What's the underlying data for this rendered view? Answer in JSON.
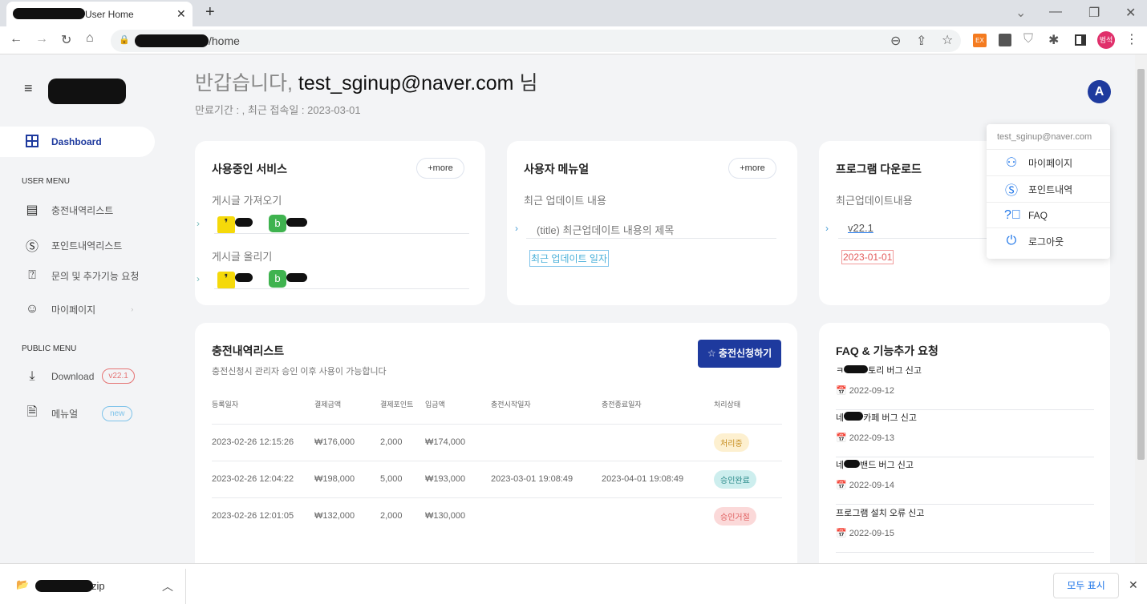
{
  "browser": {
    "tab_title": "User Home",
    "url_suffix": "/home",
    "profile": "범석",
    "ext_ex": "EX",
    "show_all": "모두 표시",
    "download_file": "zip"
  },
  "header": {
    "greeting": "반갑습니다,",
    "user": "test_sginup@naver.com",
    "suffix": "님",
    "meta": "만료기간 : , 최근 접속일 : 2023-03-01",
    "avatar": "A"
  },
  "sidebar": {
    "dashboard": "Dashboard",
    "user_menu": "USER MENU",
    "items": [
      {
        "label": "충전내역리스트",
        "icon": "cards-icon"
      },
      {
        "label": "포인트내역리스트",
        "icon": "dollar-icon"
      },
      {
        "label": "문의 및 추가기능 요청",
        "icon": "question-icon"
      },
      {
        "label": "마이페이지",
        "icon": "user-icon"
      }
    ],
    "public_menu": "PUBLIC MENU",
    "download": "Download",
    "download_badge": "v22.1",
    "manual": "메뉴얼",
    "manual_badge": "new"
  },
  "services": {
    "title": "사용중인 서비스",
    "more": "+more",
    "fetch": "게시글 가져오기",
    "post": "게시글 올리기"
  },
  "manual": {
    "title": "사용자 메뉴얼",
    "more": "+more",
    "sub": "최근 업데이트 내용",
    "item": "(title) 최근업데이트 내용의 제목",
    "date": "최근 업데이트 일자"
  },
  "program": {
    "title": "프로그램 다운로드",
    "sub": "최근업데이트내용",
    "version": "v22.1",
    "date": "2023-01-01"
  },
  "charge": {
    "title": "충전내역리스트",
    "subtitle": "충전신청시 관리자 승인 이후 사용이 가능합니다",
    "button": "☆ 충전신청하기",
    "columns": [
      "등록일자",
      "결제금액",
      "결제포인트",
      "입금액",
      "충전시작일자",
      "충전종료일자",
      "처리상태"
    ],
    "rows": [
      [
        "2023-02-26 12:15:26",
        "₩176,000",
        "2,000",
        "₩174,000",
        "",
        "",
        "처리중"
      ],
      [
        "2023-02-26 12:04:22",
        "₩198,000",
        "5,000",
        "₩193,000",
        "2023-03-01 19:08:49",
        "2023-04-01 19:08:49",
        "승인완료"
      ],
      [
        "2023-02-26 12:01:05",
        "₩132,000",
        "2,000",
        "₩130,000",
        "",
        "",
        "승인거절"
      ]
    ]
  },
  "faq": {
    "title": "FAQ & 기능추가 요청",
    "items": [
      {
        "pre": "ㅋ",
        "post": "토리 버그 신고",
        "date": "2022-09-12"
      },
      {
        "pre": "네",
        "post": "카페 버그 신고",
        "date": "2022-09-13"
      },
      {
        "pre": "네",
        "post": "밴드 버그 신고",
        "date": "2022-09-14"
      },
      {
        "pre": "",
        "post": "프로그램 설치 오류 신고",
        "date": "2022-09-15"
      }
    ]
  },
  "user_menu": {
    "email": "test_sginup@naver.com",
    "items": [
      {
        "label": "마이페이지",
        "icon": "user-icon"
      },
      {
        "label": "포인트내역",
        "icon": "dollar-icon"
      },
      {
        "label": "FAQ",
        "icon": "question-icon"
      },
      {
        "label": "로그아웃",
        "icon": "power-icon"
      }
    ]
  },
  "colors": {
    "accent": "#1e3a9e",
    "processing": "#fdf0d0",
    "approved": "#cdeeee",
    "rejected": "#fbd9d9"
  }
}
